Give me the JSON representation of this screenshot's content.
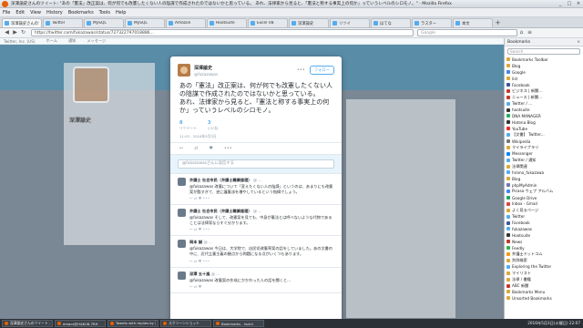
{
  "window": {
    "title": "深澤諭史さんのツイート: \"あの「憲法」改正案は、何が何でも改憲したくない人の陰謀で作成されたのではないかと思っている。 あれ、法律家から見ると、「憲法と称する事実上の何か」っていうレベルのシロモノ。\" - Mozilla Firefox",
    "controls": [
      "_",
      "□",
      "×"
    ]
  },
  "menu": [
    "File",
    "Edit",
    "View",
    "History",
    "Bookmarks",
    "Tools",
    "Help"
  ],
  "tabs": [
    {
      "label": "深澤諭史さんのツイート",
      "active": true
    },
    {
      "label": "Twitter",
      "active": false
    },
    {
      "label": "MySQL",
      "active": false
    },
    {
      "label": "MySQL",
      "active": false
    },
    {
      "label": "Amazon",
      "active": false
    },
    {
      "label": "Hootsuite",
      "active": false
    },
    {
      "label": "Excel VB",
      "active": false
    },
    {
      "label": "深澤諭史",
      "active": false
    },
    {
      "label": "リツイ",
      "active": false
    },
    {
      "label": "はてな",
      "active": false
    },
    {
      "label": "ラスター",
      "active": false
    },
    {
      "label": "本文",
      "active": false
    }
  ],
  "nav": {
    "url": "https://twitter.com/fukazawas/status/727322797018886...",
    "search_placeholder": "Google"
  },
  "twitter_bar": [
    "Twitter, Inc. (US)",
    "ホーム",
    "通知",
    "メッセージ"
  ],
  "page": {
    "profile_name": "深澤諭史"
  },
  "tweet": {
    "name": "深澤諭史",
    "handle": "@fukazawas",
    "follow_label": "フォロー",
    "more": "•••",
    "text": "あの「憲法」改正案は、何が何でも改憲したくない人の陰謀で作成されたのではないかと思っている。\nあれ、法律家から見ると、「憲法と称する事実上の何か」っていうレベルのシロモノ。",
    "stats": [
      {
        "n": "8",
        "l": "リツイート"
      },
      {
        "n": "3",
        "l": "いいね"
      }
    ],
    "time": "11:03 - 2016年5月3日",
    "actions": [
      "↩",
      "⇄",
      "♥",
      "•••"
    ],
    "reply_placeholder": "@fukazawasさんに返信する"
  },
  "replies": [
    {
      "name": "弁護士 社会市民（弁護士職業倫理）",
      "handle": "@ ...",
      "text": "@fukazawas 改憲について「変えたくない人の陰謀」というのは、あまりにも改憲案が酷すぎて、逆に護憲派を増やしているという指摘でしょう。",
      "icons": "↩  ⇄  ♥  •••"
    },
    {
      "name": "弁護士 社会市民（弁護士職業倫理）",
      "handle": "@ ...",
      "text": "@fukazawas そして、改憲案を見ても、中身が憲法とは呼べないような代物であることは法律家ならすぐ分かります。",
      "icons": "↩  ⇄  ♥  •••"
    },
    {
      "name": "岡本 誠",
      "handle": "@ ...",
      "text": "@fukazawas 今日は、大学院で、自民党改憲草案の話をしていました。あの文書の中に、近代立憲主義の観点から問題になる点がいくつもあります。",
      "icons": "↩  ⇄  ♥  •••"
    },
    {
      "name": "深澤 五十嵐",
      "handle": "@ ...",
      "text": "@fukazawas 改憲案の作成にかかわった人の話を聞くと...",
      "icons": "↩  ⇄  ♥"
    }
  ],
  "sidebar": {
    "title": "Bookmarks",
    "close": "×",
    "search_placeholder": "Search",
    "items": [
      {
        "label": "Bookmarks Toolbar",
        "color": "#d8a93a"
      },
      {
        "label": "Blog",
        "color": "#d8a93a"
      },
      {
        "label": "Google",
        "color": "#4285f4"
      },
      {
        "label": "list",
        "color": "#d8a93a"
      },
      {
        "label": "Facebook",
        "color": "#3b5998"
      },
      {
        "label": "ビジネス | 新聞...",
        "color": "#c0392b"
      },
      {
        "label": "ニュース | 新聞...",
        "color": "#c0392b"
      },
      {
        "label": "Twitter / ...",
        "color": "#55acee"
      },
      {
        "label": "hootsuite",
        "color": "#333333"
      },
      {
        "label": "DNA MANAGER",
        "color": "#27ae60"
      },
      {
        "label": "Hatena Blog",
        "color": "#333333"
      },
      {
        "label": "YouTube",
        "color": "#e52d27"
      },
      {
        "label": "【文書】 Twitter...",
        "color": "#55acee"
      },
      {
        "label": "Wikipedia",
        "color": "#777777"
      },
      {
        "label": "マイライブラリ",
        "color": "#d8a93a"
      },
      {
        "label": "Messenger",
        "color": "#0084ff"
      },
      {
        "label": "Twitter / 通知",
        "color": "#55acee"
      },
      {
        "label": "法律関連",
        "color": "#d8a93a"
      },
      {
        "label": "hirono_fukazawa",
        "color": "#55acee"
      },
      {
        "label": "Blog",
        "color": "#d8a93a"
      },
      {
        "label": "phpMyAdmin",
        "color": "#6c78af"
      },
      {
        "label": "Picasa ウェブ アルバム",
        "color": "#4285f4"
      },
      {
        "label": "Google Drive",
        "color": "#1fa463"
      },
      {
        "label": "Inbox - Gmail",
        "color": "#d44638"
      },
      {
        "label": "よく見るページ",
        "color": "#d8a93a"
      },
      {
        "label": "Twitter",
        "color": "#55acee"
      },
      {
        "label": "Facebook",
        "color": "#3b5998"
      },
      {
        "label": "fukazawas",
        "color": "#55acee"
      },
      {
        "label": "Hootsuite",
        "color": "#333333"
      },
      {
        "label": "News",
        "color": "#c0392b"
      },
      {
        "label": "Feedly",
        "color": "#2bb24c"
      },
      {
        "label": "弁護士ドットコム",
        "color": "#f39c12"
      },
      {
        "label": "判例検索",
        "color": "#d8a93a"
      },
      {
        "label": "Exploring the Twitter",
        "color": "#55acee"
      },
      {
        "label": "マイリスト",
        "color": "#d8a93a"
      },
      {
        "label": "法律 / 書籍",
        "color": "#d8a93a"
      },
      {
        "label": "ABC 新聞",
        "color": "#c0392b"
      },
      {
        "label": "Bookmarks Menu",
        "color": "#d8a93a"
      },
      {
        "label": "Unsorted Bookmarks",
        "color": "#d8a93a"
      }
    ]
  },
  "taskbar": {
    "items": [
      {
        "label": "深澤諭史さんのツイート - Mozilla"
      },
      {
        "label": "emacs@HAKU8-7RH"
      },
      {
        "label": "Tweets with replies by 深澤諭史"
      },
      {
        "label": "スクリーンショット"
      },
      {
        "label": "Bookmarks - lsukii"
      }
    ],
    "clock": "2016年5月3日(火曜日) 22:07"
  }
}
